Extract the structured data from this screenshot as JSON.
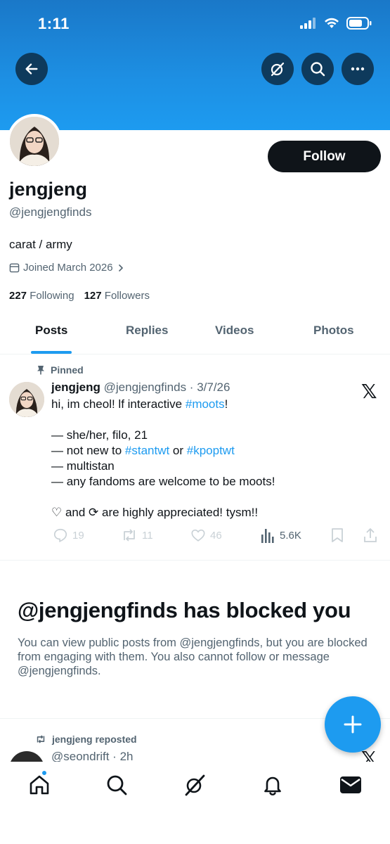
{
  "status_bar": {
    "time": "1:11"
  },
  "header": {
    "back_icon": "arrow-left-icon",
    "grok_icon": "grok-icon",
    "search_icon": "search-icon",
    "more_icon": "more-icon",
    "banner_color": "#1d9bf0"
  },
  "profile": {
    "display_name": "jengjeng",
    "handle": "@jengjengfinds",
    "bio": "carat / army",
    "joined": "Joined March 2026",
    "following_count": "227",
    "following_label": "Following",
    "followers_count": "127",
    "followers_label": "Followers",
    "follow_label": "Follow"
  },
  "tabs": [
    "Posts",
    "Replies",
    "Videos",
    "Photos"
  ],
  "pinned_post": {
    "pinned_label": "Pinned",
    "name": "jengjeng",
    "handle_date": "@jengjengfinds · 3/7/26",
    "lines": {
      "l1_pre": "hi, im cheol! lf interactive ",
      "l1_tag": "#moots",
      "l1_post": "!",
      "l2": "— she/her, filo, 21",
      "l3_pre": "— not new to ",
      "l3_tag1": "#stantwt",
      "l3_mid": " or ",
      "l3_tag2": "#kpoptwt",
      "l4": "— multistan",
      "l5": "— any fandoms are welcome to be moots!",
      "l6": "♡ and ⟳ are highly appreciated! tysm!!"
    },
    "replies": "19",
    "reposts": "11",
    "likes": "46",
    "views": "5.6K"
  },
  "blocked": {
    "title": "@jengjengfinds has blocked you",
    "description": "You can view public posts from @jengjengfinds, but you are blocked from engaging with them. You also cannot follow or message @jengjengfinds."
  },
  "repost_item": {
    "label": "jengjeng reposted",
    "handle_time": "@seondrift · 2h"
  },
  "bottom_nav": [
    "home-icon",
    "search-icon",
    "grok-icon",
    "notifications-icon",
    "messages-icon"
  ],
  "accent_color": "#1d9bf0"
}
